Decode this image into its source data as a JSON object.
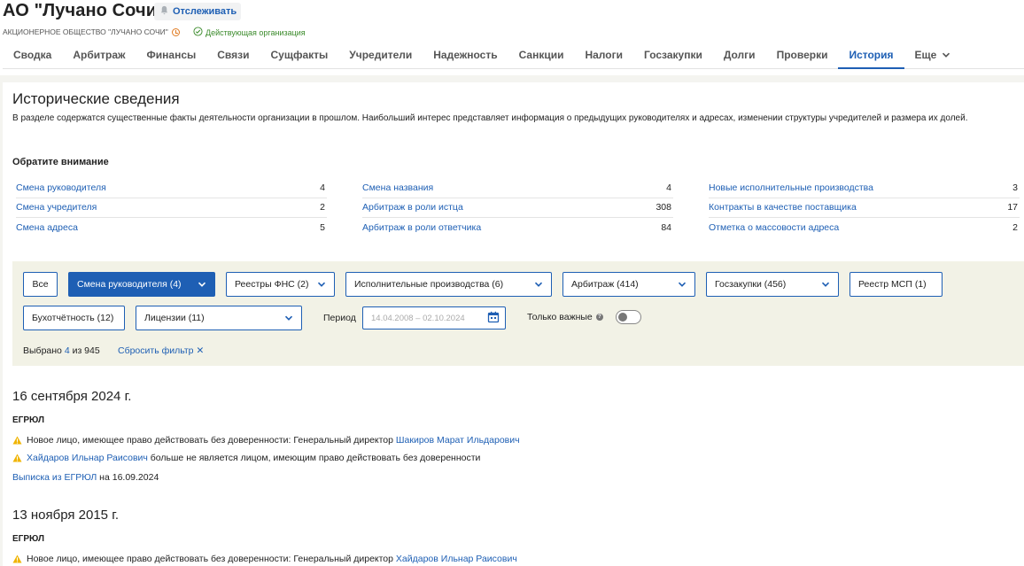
{
  "company": {
    "title": "АО \"Лучано Сочи\"",
    "track_label": "Отслеживать",
    "full_name": "АКЦИОНЕРНОЕ ОБЩЕСТВО \"ЛУЧАНО СОЧИ\"",
    "status": "Действующая организация"
  },
  "tabs": [
    "Сводка",
    "Арбитраж",
    "Финансы",
    "Связи",
    "Сущфакты",
    "Учредители",
    "Надежность",
    "Санкции",
    "Налоги",
    "Госзакупки",
    "Долги",
    "Проверки",
    "История",
    "Еще"
  ],
  "active_tab": "История",
  "section": {
    "title": "Исторические сведения",
    "intro": "В разделе содержатся существенные факты деятельности организации в прошлом. Наибольший интерес представляет информация о предыдущих руководителях и адресах, изменении структуры учредителей и размера их долей.",
    "attention": "Обратите внимание"
  },
  "facts": [
    [
      {
        "label": "Смена руководителя",
        "count": "4"
      },
      {
        "label": "Смена учредителя",
        "count": "2"
      },
      {
        "label": "Смена адреса",
        "count": "5"
      }
    ],
    [
      {
        "label": "Смена названия",
        "count": "4"
      },
      {
        "label": "Арбитраж в роли истца",
        "count": "308"
      },
      {
        "label": "Арбитраж в роли ответчика",
        "count": "84"
      }
    ],
    [
      {
        "label": "Новые исполнительные производства",
        "count": "3"
      },
      {
        "label": "Контракты в качестве поставщика",
        "count": "17"
      },
      {
        "label": "Отметка о массовости адреса",
        "count": "2"
      }
    ]
  ],
  "filters": {
    "all": "Все",
    "head_change": "Смена руководителя (4)",
    "fns": "Реестры ФНС (2)",
    "enforcement": "Исполнительные производства (6)",
    "arbitration": "Арбитраж (414)",
    "procurement": "Госзакупки (456)",
    "msp": "Реестр МСП (1)",
    "accounting": "Бухотчётность (12)",
    "licenses": "Лицензии (11)",
    "period_label": "Период",
    "period_value": "14.04.2008 – 02.10.2024",
    "important_label": "Только важные",
    "important_on": false,
    "selected_prefix": "Выбрано",
    "selected_count": "4",
    "selected_suffix": "из 945",
    "reset": "Сбросить фильтр"
  },
  "events": [
    {
      "date": "16 сентября 2024 г.",
      "source": "ЕГРЮЛ",
      "items": [
        {
          "text_before": "Новое лицо, имеющее право действовать без доверенности: Генеральный директор ",
          "link": "Шакиров Марат Ильдарович",
          "text_after": ""
        },
        {
          "text_before": "",
          "link": "Хайдаров Ильнар Раисович",
          "text_after": " больше не является лицом, имеющим право действовать без доверенности"
        }
      ],
      "extract_link": "Выписка из ЕГРЮЛ",
      "extract_date": "на 16.09.2024"
    },
    {
      "date": "13 ноября 2015 г.",
      "source": "ЕГРЮЛ",
      "items": [
        {
          "text_before": "Новое лицо, имеющее право действовать без доверенности: Генеральный директор ",
          "link": "Хайдаров Ильнар Раисович",
          "text_after": ""
        }
      ]
    }
  ],
  "colors": {
    "accent": "#1e5fb4",
    "warning": "#f0b400",
    "active_status": "#3a8a2a",
    "filter_panel": "#f2f2e6"
  }
}
